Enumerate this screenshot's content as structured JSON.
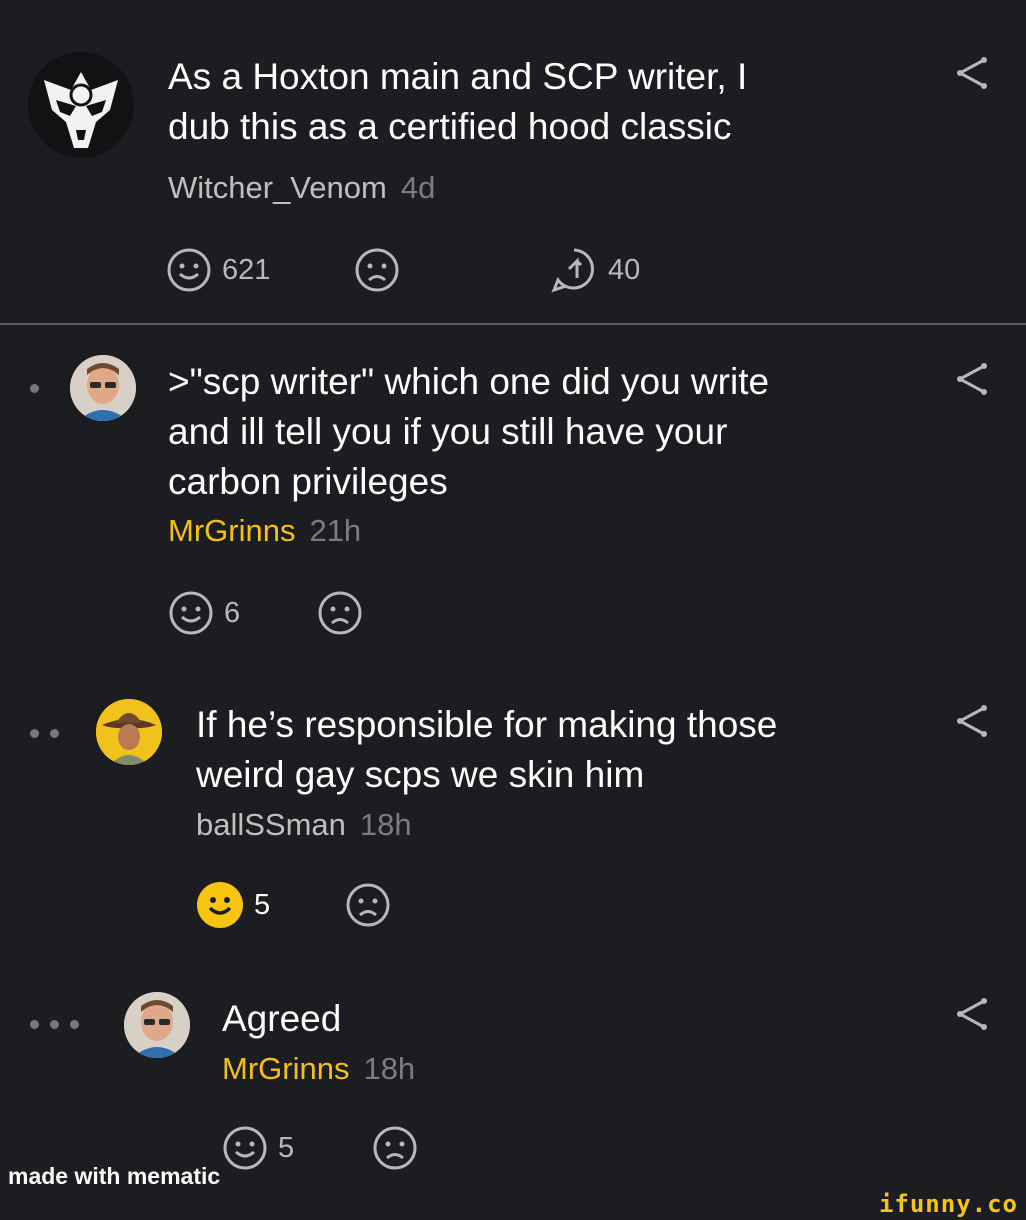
{
  "comments": [
    {
      "text": "As a Hoxton main and SCP writer, I\ndub this as a certified hood classic",
      "user": "Witcher_Venom",
      "time": "4d",
      "likes": "621",
      "replies": "40",
      "avatar_icon": "mask-logo-avatar",
      "user_color": "#bfbfbf"
    },
    {
      "text": ">\"scp writer\" which one did you write\nand ill tell you if you still have your\ncarbon privileges",
      "user": "MrGrinns",
      "time": "21h",
      "likes": "6",
      "avatar_icon": "man-with-glasses-avatar",
      "user_color": "#f3c01a"
    },
    {
      "text": "If he’s responsible for making those\nweird gay scps we skin him",
      "user": "ballSSman",
      "time": "18h",
      "likes": "5",
      "liked": true,
      "avatar_icon": "cowboy-avatar",
      "user_color": "#bfbfbf"
    },
    {
      "text": "Agreed",
      "user": "MrGrinns",
      "time": "18h",
      "likes": "5",
      "avatar_icon": "man-with-glasses-avatar",
      "user_color": "#f3c01a"
    }
  ],
  "watermarks": {
    "left": "made with mematic",
    "right": "ifunny.co"
  },
  "colors": {
    "background": "#1c1d21",
    "liked_smile": "#f7c510",
    "icon_stroke": "#b8b8b8"
  }
}
